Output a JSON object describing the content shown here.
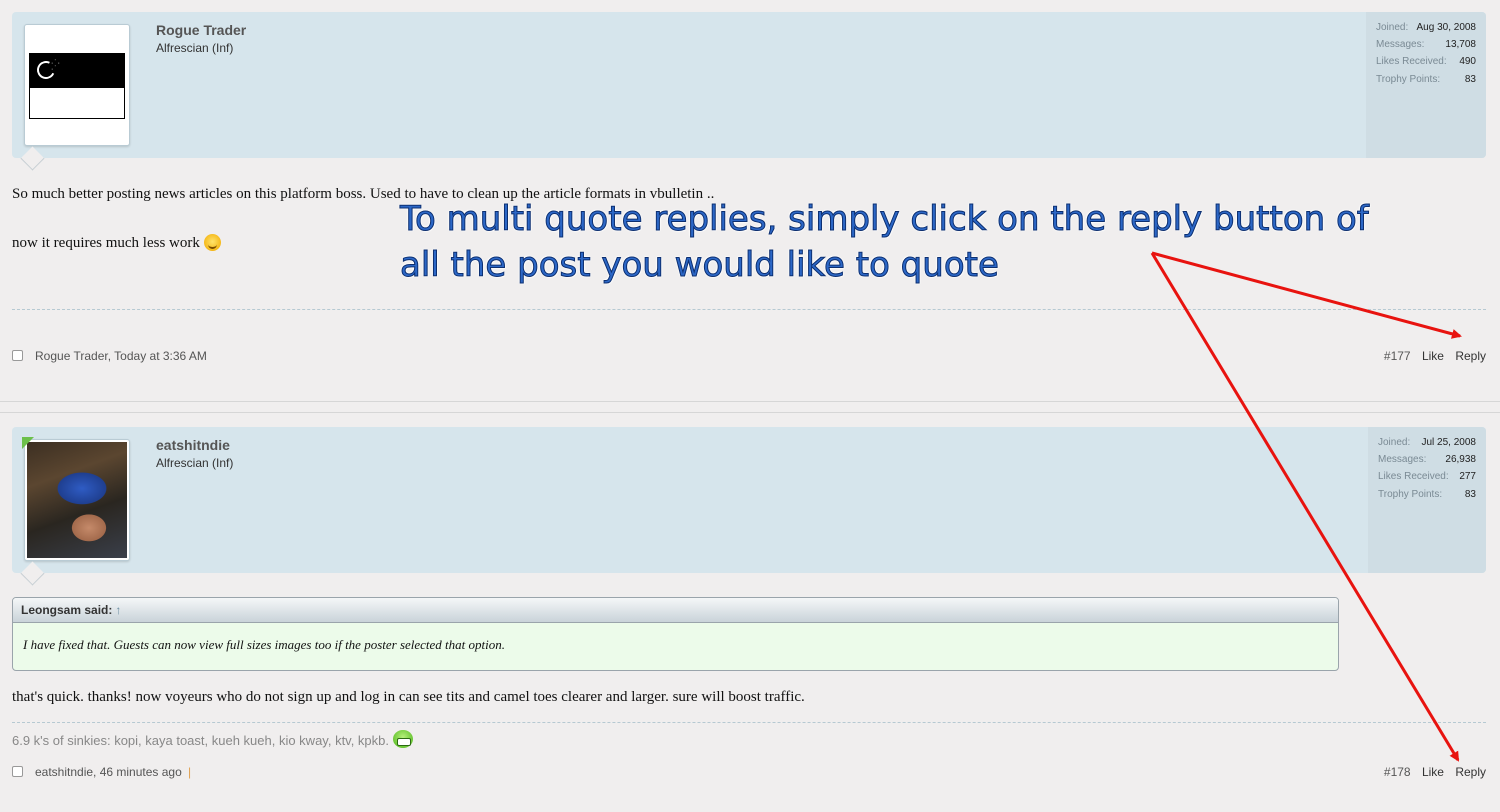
{
  "posts": [
    {
      "username": "Rogue Trader",
      "user_title": "Alfrescian (Inf)",
      "stats": [
        {
          "label": "Joined:",
          "value": "Aug 30, 2008"
        },
        {
          "label": "Messages:",
          "value": "13,708"
        },
        {
          "label": "Likes Received:",
          "value": "490"
        },
        {
          "label": "Trophy Points:",
          "value": "83"
        }
      ],
      "message_line1": "So much better posting news articles on this platform boss. Used to have to clean up the article formats in vbulletin ..",
      "message_line2": "now it requires much less work",
      "author_date": "Rogue Trader, Today at 3:36 AM",
      "post_number": "#177",
      "like_label": "Like",
      "reply_label": "Reply",
      "avatar_icon": "singapore-flag-icon",
      "emoticon": "smile-icon"
    },
    {
      "username": "eatshitndie",
      "user_title": "Alfrescian (Inf)",
      "stats": [
        {
          "label": "Joined:",
          "value": "Jul 25, 2008"
        },
        {
          "label": "Messages:",
          "value": "26,938"
        },
        {
          "label": "Likes Received:",
          "value": "277"
        },
        {
          "label": "Trophy Points:",
          "value": "83"
        }
      ],
      "quote_header": "Leongsam said:",
      "quote_text": "I have fixed that. Guests can now view full sizes images too if the poster selected that option.",
      "message": "that's quick. thanks! now voyeurs who do not sign up and log in can see tits and camel toes clearer and larger. sure will boost traffic.",
      "signature": "6.9 k's of sinkies: kopi, kaya toast, kueh kueh, kio kway, ktv, kpkb.",
      "author_date": "eatshitndie, 46 minutes ago",
      "post_number": "#178",
      "like_label": "Like",
      "reply_label": "Reply",
      "emoticon": "grin-icon"
    }
  ],
  "annotation": {
    "line1": "To multi quote replies, simply click on the reply button of",
    "line2": "all the post you would like to quote",
    "color": "#2c67c6",
    "arrow_color": "#e8130f"
  }
}
